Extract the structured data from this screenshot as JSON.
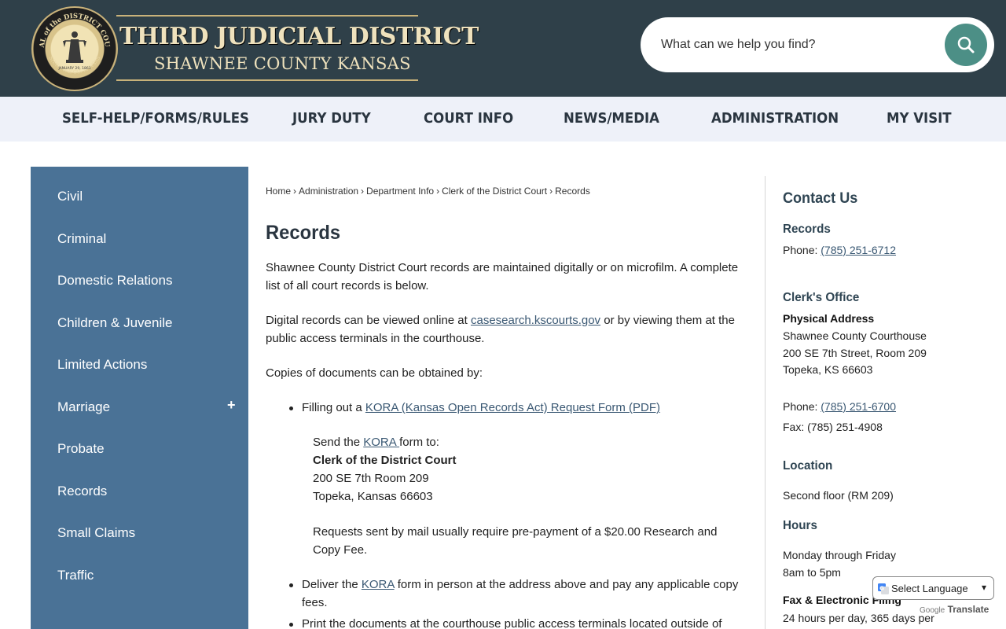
{
  "header": {
    "title": "THIRD JUDICIAL DISTRICT",
    "subtitle": "SHAWNEE COUNTY KANSAS",
    "seal_icon": "court-seal-logo",
    "seal_text_top": "SEAL of the DISTRICT COURT",
    "seal_text_bottom": "SHAWNEE CO. KANSAS",
    "seal_date": "JANUARY 29, 1861",
    "search_placeholder": "What can we help you find?",
    "search_icon": "search-icon",
    "background_color": "#2f4049",
    "accent_color": "#4c8f86"
  },
  "nav": {
    "items": [
      "SELF-HELP/FORMS/RULES",
      "JURY DUTY",
      "COURT INFO",
      "NEWS/MEDIA",
      "ADMINISTRATION",
      "MY VISIT"
    ]
  },
  "sidebar": {
    "items": [
      "Civil",
      "Criminal",
      "Domestic Relations",
      "Children & Juvenile",
      "Limited Actions",
      "Marriage",
      "Probate",
      "Records",
      "Small Claims",
      "Traffic"
    ],
    "expand_symbol": "+",
    "background_color": "#4a7296"
  },
  "breadcrumb": [
    "Home",
    "Administration",
    "Department Info",
    "Clerk of the District Court",
    "Records"
  ],
  "breadcrumb_separator": "›",
  "main": {
    "title": "Records",
    "intro": "Shawnee County District Court records are maintained digitally or on microfilm. A complete list of all court records is below.",
    "digital_before": "Digital records can be viewed online at ",
    "digital_link": "casesearch.kscourts.gov",
    "digital_after": " or by viewing them at the public access terminals in the courthouse.",
    "copies_intro": "Copies of documents can be obtained by:",
    "bullet1_before": "Filling out a ",
    "bullet1_link": "KORA (Kansas Open Records Act) Request Form (PDF)",
    "send_before": "Send the ",
    "send_link": "KORA ",
    "send_after": "form to:",
    "address_name": "Clerk of the District Court",
    "address_line1": "200 SE 7th Room 209",
    "address_line2": "Topeka, Kansas 66603",
    "mail_note": "Requests sent by mail usually require pre-payment of a $20.00 Research and Copy Fee.",
    "bullet2_before": "Deliver the ",
    "bullet2_link": "KORA",
    "bullet2_after": " form in person at the address above and pay any applicable copy fees.",
    "bullet3": "Print the documents at the courthouse public access terminals located outside of"
  },
  "contact": {
    "title": "Contact Us",
    "records_heading": "Records",
    "records_phone_label": "Phone: ",
    "records_phone": "(785) 251-6712",
    "clerk_heading": "Clerk's Office",
    "physical_label": "Physical Address",
    "addr1": "Shawnee County Courthouse",
    "addr2": "200 SE 7th Street, Room 209",
    "addr3": "Topeka, KS 66603",
    "clerk_phone_label": "Phone: ",
    "clerk_phone": "(785) 251-6700",
    "fax": "Fax: (785) 251-4908",
    "location_heading": "Location",
    "location_text": "Second floor (RM 209)",
    "hours_heading": "Hours",
    "hours1": "Monday through Friday",
    "hours2": "8am to 5pm",
    "fax_filing_heading": "Fax & Electronic Filing",
    "fax_filing_text": "24 hours per day, 365 days per"
  },
  "translate": {
    "label": "Select Language",
    "powered_by": "Google",
    "translate_text": "Translate",
    "icon": "google-translate-icon"
  }
}
